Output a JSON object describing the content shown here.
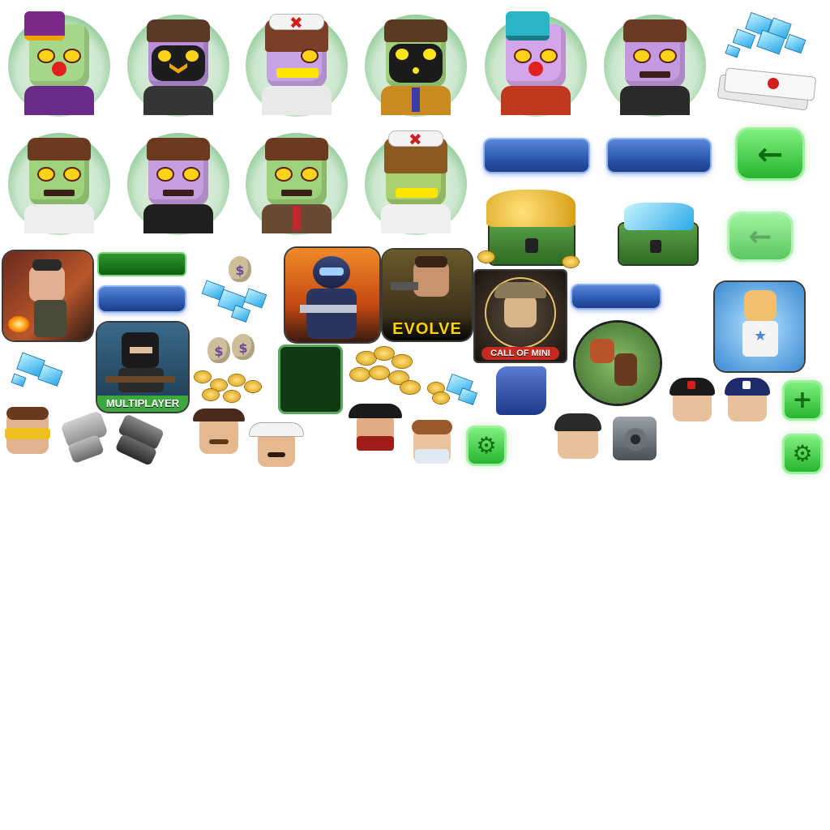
{
  "colors": {
    "zombie_green": "#9ed37c",
    "zombie_purple": "#b98fd6",
    "button_green": "#27b52e",
    "bar_blue": "#2f5bb3",
    "bar_green": "#0d5c12",
    "coin_gold": "#e3b323",
    "gem_blue": "#2aa9e8"
  },
  "tiles": {
    "evolve_label": "EVOLVE",
    "multiplayer_label": "MULTIPLAYER",
    "call_of_mini_label": "CALL OF MINI"
  },
  "icons": {
    "back_arrow": "←",
    "plus": "+",
    "gear": "⚙",
    "money_sign": "$",
    "star": "★",
    "nurse_cross": "✖"
  }
}
